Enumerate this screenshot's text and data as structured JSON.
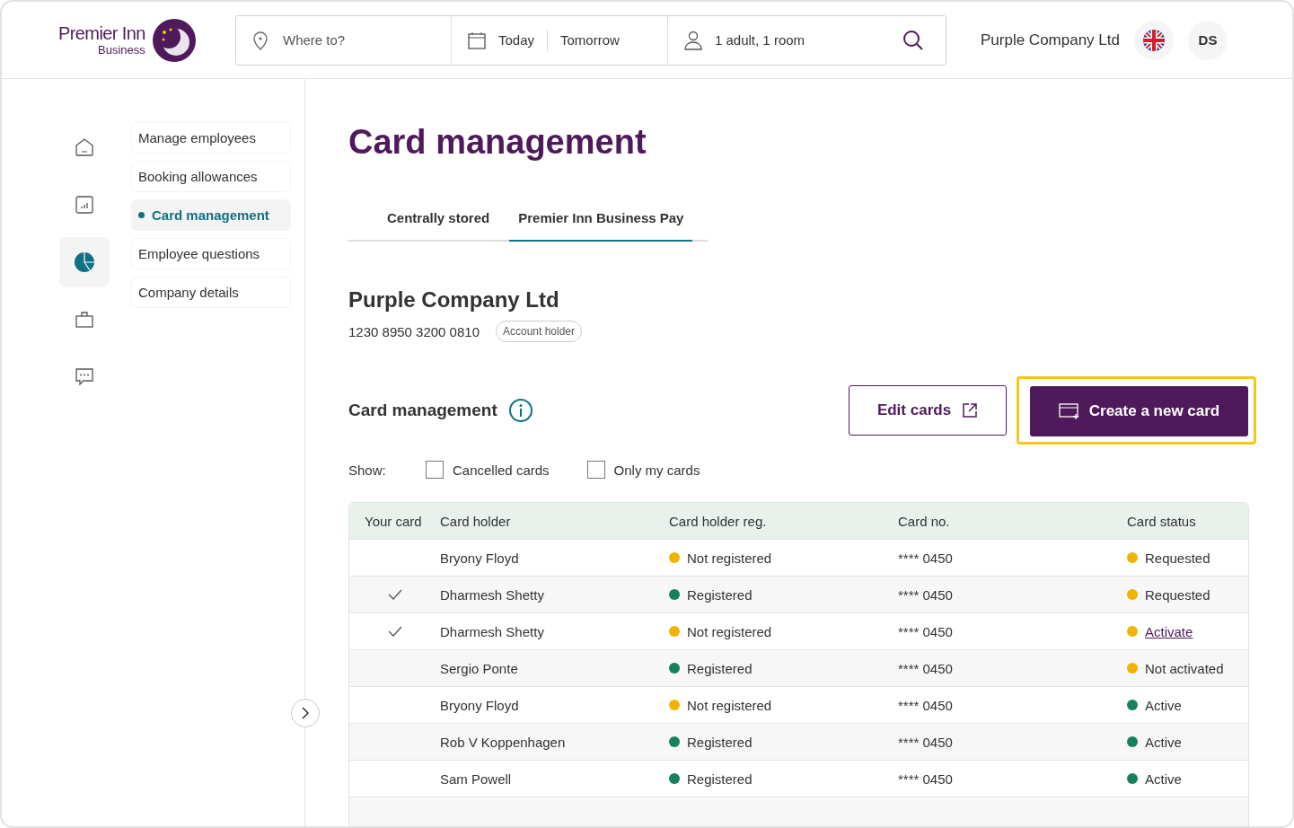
{
  "header": {
    "logo": {
      "name": "Premier Inn",
      "sub": "Business"
    },
    "search": {
      "destination_placeholder": "Where to?",
      "check_in": "Today",
      "check_out": "Tomorrow",
      "guests": "1 adult, 1 room"
    },
    "company": "Purple Company Ltd",
    "user_initials": "DS"
  },
  "icon_rail": [
    {
      "kind": "home",
      "selected": false
    },
    {
      "kind": "report",
      "selected": false
    },
    {
      "kind": "pie",
      "selected": true
    },
    {
      "kind": "bag",
      "selected": false
    },
    {
      "kind": "chat",
      "selected": false
    }
  ],
  "sidebar": {
    "items": [
      {
        "label": "Manage employees",
        "selected": false
      },
      {
        "label": "Booking allowances",
        "selected": false
      },
      {
        "label": "Card management",
        "selected": true
      },
      {
        "label": "Employee questions",
        "selected": false
      },
      {
        "label": "Company details",
        "selected": false
      }
    ]
  },
  "page_title": "Card management",
  "tabs": [
    {
      "label": "Centrally stored",
      "selected": false
    },
    {
      "label": "Premier Inn Business Pay",
      "selected": true
    }
  ],
  "account": {
    "name": "Purple Company Ltd",
    "number": "1230 8950 3200 0810",
    "badge": "Account holder"
  },
  "section": {
    "title": "Card management",
    "edit_button": "Edit cards",
    "create_button": "Create a new card",
    "create_focused": true
  },
  "filters": {
    "label": "Show:",
    "options": [
      {
        "label": "Cancelled cards",
        "checked": false
      },
      {
        "label": "Only my cards",
        "checked": false
      }
    ]
  },
  "table": {
    "columns": [
      "Your card",
      "Card holder",
      "Card holder reg.",
      "Card no.",
      "Card status"
    ],
    "rows": [
      {
        "yours": false,
        "holder": "Bryony Floyd",
        "reg": {
          "label": "Not registered",
          "color": "#f0b400"
        },
        "card_no": "**** 0450",
        "status": {
          "label": "Requested",
          "color": "#f0b400",
          "kind": "text"
        }
      },
      {
        "yours": true,
        "holder": "Dharmesh Shetty",
        "reg": {
          "label": "Registered",
          "color": "#15825a"
        },
        "card_no": "**** 0450",
        "status": {
          "label": "Requested",
          "color": "#f0b400",
          "kind": "text"
        }
      },
      {
        "yours": true,
        "holder": "Dharmesh Shetty",
        "reg": {
          "label": "Not registered",
          "color": "#f0b400"
        },
        "card_no": "**** 0450",
        "status": {
          "label": "Activate",
          "color": "#f0b400",
          "kind": "link"
        }
      },
      {
        "yours": false,
        "holder": "Sergio Ponte",
        "reg": {
          "label": "Registered",
          "color": "#15825a"
        },
        "card_no": "**** 0450",
        "status": {
          "label": "Not activated",
          "color": "#f0b400",
          "kind": "text"
        }
      },
      {
        "yours": false,
        "holder": "Bryony Floyd",
        "reg": {
          "label": "Not registered",
          "color": "#f0b400"
        },
        "card_no": "**** 0450",
        "status": {
          "label": "Active",
          "color": "#15825a",
          "kind": "text"
        }
      },
      {
        "yours": false,
        "holder": "Rob V Koppenhagen",
        "reg": {
          "label": "Registered",
          "color": "#15825a"
        },
        "card_no": "**** 0450",
        "status": {
          "label": "Active",
          "color": "#15825a",
          "kind": "text"
        }
      },
      {
        "yours": false,
        "holder": "Sam Powell",
        "reg": {
          "label": "Registered",
          "color": "#15825a"
        },
        "card_no": "**** 0450",
        "status": {
          "label": "Active",
          "color": "#15825a",
          "kind": "text"
        }
      }
    ]
  }
}
